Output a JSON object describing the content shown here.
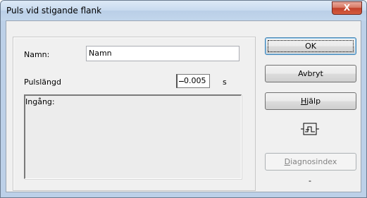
{
  "window": {
    "title": "Puls vid stigande flank",
    "close_symbol": "X"
  },
  "form": {
    "name_label": "Namn:",
    "name_value": "Namn",
    "pulse_label": "Pulslängd",
    "pulse_value": "0.005",
    "pulse_unit": "s",
    "input_label": "Ingång:"
  },
  "buttons": {
    "ok": "OK",
    "cancel": "Avbryt",
    "help_first": "H",
    "help_rest": "jälp",
    "diag_first": "D",
    "diag_rest": "iagnosindex"
  },
  "status": {
    "diag_value": "-"
  },
  "icons": {
    "pulse": "pulse-edge-icon",
    "close": "close-icon"
  }
}
